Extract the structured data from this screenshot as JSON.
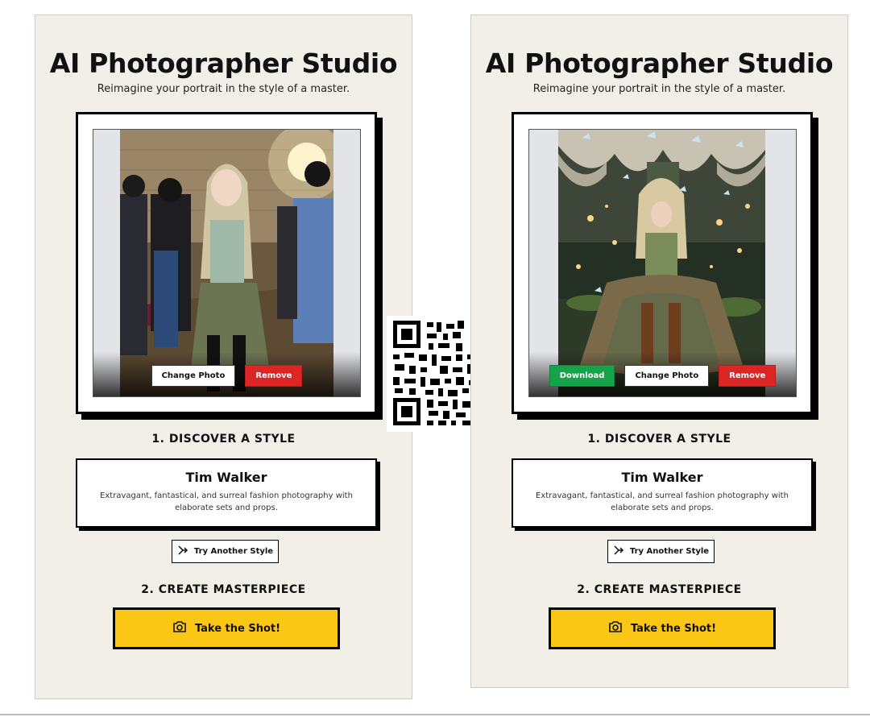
{
  "panels": [
    {
      "title": "AI Photographer Studio",
      "subtitle": "Reimagine your portrait in the style of a master.",
      "photo_buttons": {
        "change": "Change Photo",
        "remove": "Remove"
      },
      "section1": "1. DISCOVER A STYLE",
      "style": {
        "name": "Tim Walker",
        "description": "Extravagant, fantastical, and surreal fashion photography with elaborate sets and props."
      },
      "try_another": "Try Another Style",
      "section2": "2. CREATE MASTERPIECE",
      "shot_button": "Take the Shot!"
    },
    {
      "title": "AI Photographer Studio",
      "subtitle": "Reimagine your portrait in the style of a master.",
      "photo_buttons": {
        "download": "Download",
        "change": "Change Photo",
        "remove": "Remove"
      },
      "section1": "1. DISCOVER A STYLE",
      "style": {
        "name": "Tim Walker",
        "description": "Extravagant, fantastical, and surreal fashion photography with elaborate sets and props."
      },
      "try_another": "Try Another Style",
      "section2": "2. CREATE MASTERPIECE",
      "shot_button": "Take the Shot!"
    }
  ],
  "colors": {
    "panel_bg": "#f2efe9",
    "accent_yellow": "#fac715",
    "remove_red": "#dc2626",
    "download_green": "#16a34a"
  },
  "icons": {
    "try_another": "shuffle-icon",
    "shot": "camera-icon"
  }
}
